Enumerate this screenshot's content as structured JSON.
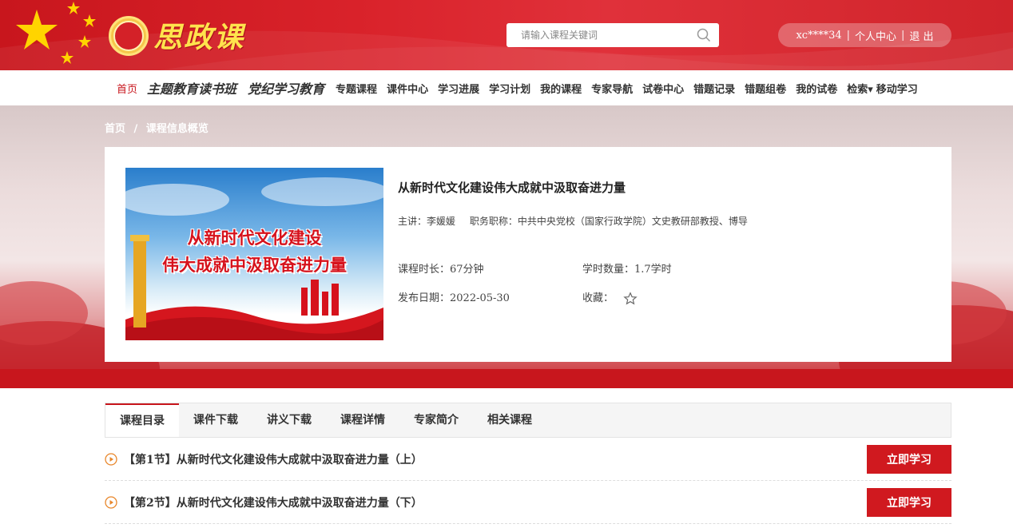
{
  "header": {
    "logo_text": "思政课",
    "search": {
      "placeholder": "请输入课程关键词"
    },
    "user": {
      "name": "xc****34",
      "center": "个人中心",
      "logout": "退 出",
      "separator": "|"
    }
  },
  "nav": {
    "items": [
      {
        "label": "首页",
        "active": true
      },
      {
        "label": "主题教育读书班"
      },
      {
        "label": "党纪学习教育"
      },
      {
        "label": "专题课程"
      },
      {
        "label": "课件中心"
      },
      {
        "label": "学习进展"
      },
      {
        "label": "学习计划"
      },
      {
        "label": "我的课程"
      },
      {
        "label": "专家导航"
      },
      {
        "label": "试卷中心"
      },
      {
        "label": "错题记录"
      },
      {
        "label": "错题组卷"
      },
      {
        "label": "我的试卷"
      },
      {
        "label": "检索▾"
      },
      {
        "label": "移动学习"
      }
    ]
  },
  "breadcrumb": {
    "home": "首页",
    "sep": "/",
    "current": "课程信息概览"
  },
  "course": {
    "cover_line1": "从新时代文化建设",
    "cover_line2": "伟大成就中汲取奋进力量",
    "title": "从新时代文化建设伟大成就中汲取奋进力量",
    "lecturer": "主讲：李媛媛",
    "position": "职务职称：中共中央党校（国家行政学院）文史教研部教授、博导",
    "duration": "课程时长：67分钟",
    "credits": "学时数量：1.7学时",
    "date": "发布日期：2022-05-30",
    "favorite": "收藏："
  },
  "tabs": [
    {
      "label": "课程目录",
      "active": true
    },
    {
      "label": "课件下载"
    },
    {
      "label": "讲义下载"
    },
    {
      "label": "课程详情"
    },
    {
      "label": "专家简介"
    },
    {
      "label": "相关课程"
    }
  ],
  "lessons": [
    {
      "title": "【第1节】从新时代文化建设伟大成就中汲取奋进力量（上）",
      "button": "立即学习"
    },
    {
      "title": "【第2节】从新时代文化建设伟大成就中汲取奋进力量（下）",
      "button": "立即学习"
    }
  ],
  "colors": {
    "primary": "#c8161d",
    "gold": "#ffe34d"
  }
}
